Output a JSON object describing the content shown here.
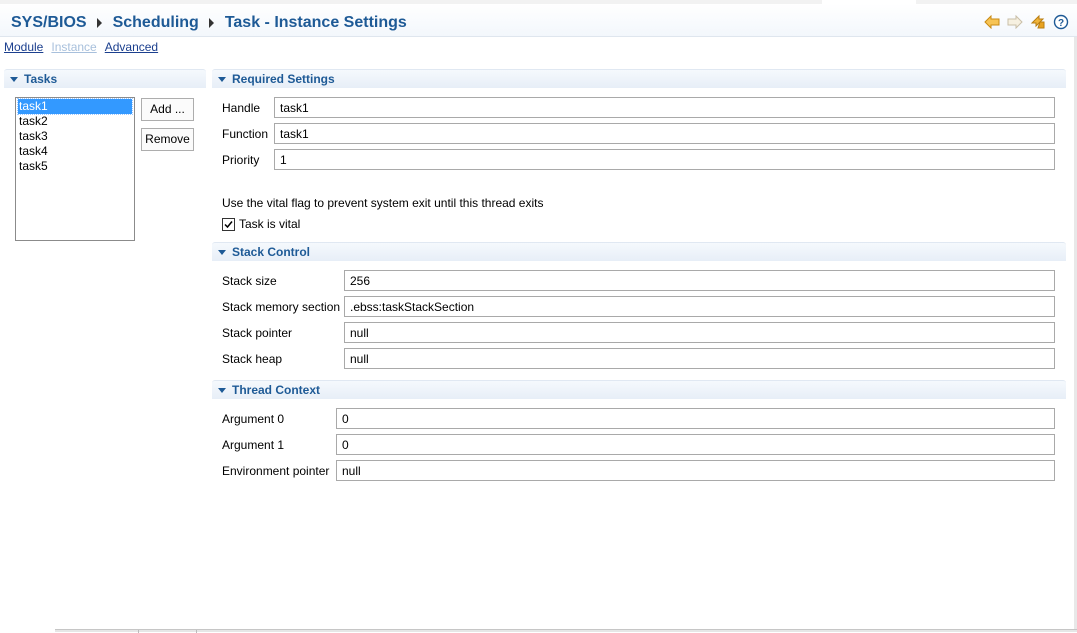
{
  "breadcrumb": {
    "items": [
      "SYS/BIOS",
      "Scheduling",
      "Task - Instance Settings"
    ]
  },
  "header_icons": [
    "back-arrow-icon",
    "forward-arrow-icon",
    "sync-icon",
    "help-icon"
  ],
  "view_links": {
    "module": "Module",
    "instance": "Instance",
    "advanced": "Advanced"
  },
  "tasks_panel": {
    "title": "Tasks",
    "items": [
      "task1",
      "task2",
      "task3",
      "task4",
      "task5"
    ],
    "selected": "task1",
    "add_label": "Add ...",
    "remove_label": "Remove"
  },
  "required": {
    "title": "Required Settings",
    "handle_label": "Handle",
    "handle_value": "task1",
    "function_label": "Function",
    "function_value": "task1",
    "priority_label": "Priority",
    "priority_value": "1",
    "vital_note": "Use the vital flag to prevent system exit until this thread exits",
    "vital_label": "Task is vital",
    "vital_checked": true
  },
  "stack": {
    "title": "Stack Control",
    "size_label": "Stack size",
    "size_value": "256",
    "section_label": "Stack memory section",
    "section_value": ".ebss:taskStackSection",
    "pointer_label": "Stack pointer",
    "pointer_value": "null",
    "heap_label": "Stack heap",
    "heap_value": "null"
  },
  "thread": {
    "title": "Thread Context",
    "arg0_label": "Argument 0",
    "arg0_value": "0",
    "arg1_label": "Argument 1",
    "arg1_value": "0",
    "env_label": "Environment pointer",
    "env_value": "null"
  },
  "colors": {
    "accent": "#1e5a96",
    "selection": "#3399ff",
    "link": "#1b3f8e",
    "link_disabled": "#a8c0dc",
    "icon_orange": "#e8a21f"
  }
}
